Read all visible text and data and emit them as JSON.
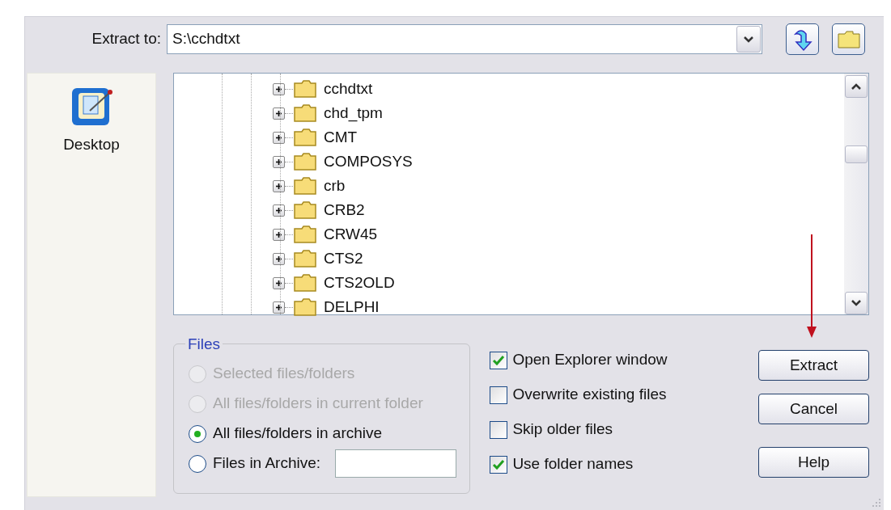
{
  "extract_to": {
    "label": "Extract to:",
    "value": "S:\\cchdtxt"
  },
  "sidebar": {
    "items": [
      {
        "label": "Desktop"
      }
    ]
  },
  "tree": {
    "items": [
      {
        "label": "cchdtxt",
        "expanded": false
      },
      {
        "label": "chd_tpm",
        "expanded": false
      },
      {
        "label": "CMT",
        "expanded": false
      },
      {
        "label": "COMPOSYS",
        "expanded": false
      },
      {
        "label": "crb",
        "expanded": false
      },
      {
        "label": "CRB2",
        "expanded": false
      },
      {
        "label": "CRW45",
        "expanded": false
      },
      {
        "label": "CTS2",
        "expanded": false
      },
      {
        "label": "CTS2OLD",
        "expanded": false
      },
      {
        "label": "DELPHI",
        "expanded": false
      }
    ]
  },
  "files_group": {
    "title": "Files",
    "options": [
      {
        "label": "Selected files/folders",
        "selected": false,
        "disabled": true
      },
      {
        "label": "All files/folders in current folder",
        "selected": false,
        "disabled": true
      },
      {
        "label": "All files/folders in archive",
        "selected": true,
        "disabled": false
      },
      {
        "label": "Files in Archive:",
        "selected": false,
        "disabled": false,
        "kind": "field"
      }
    ]
  },
  "checkboxes": [
    {
      "label": "Open Explorer window",
      "checked": true
    },
    {
      "label": "Overwrite existing files",
      "checked": false
    },
    {
      "label": "Skip older files",
      "checked": false
    },
    {
      "label": "Use folder names",
      "checked": true
    }
  ],
  "buttons": [
    {
      "label": "Extract"
    },
    {
      "label": "Cancel"
    },
    {
      "label": "Help"
    }
  ]
}
